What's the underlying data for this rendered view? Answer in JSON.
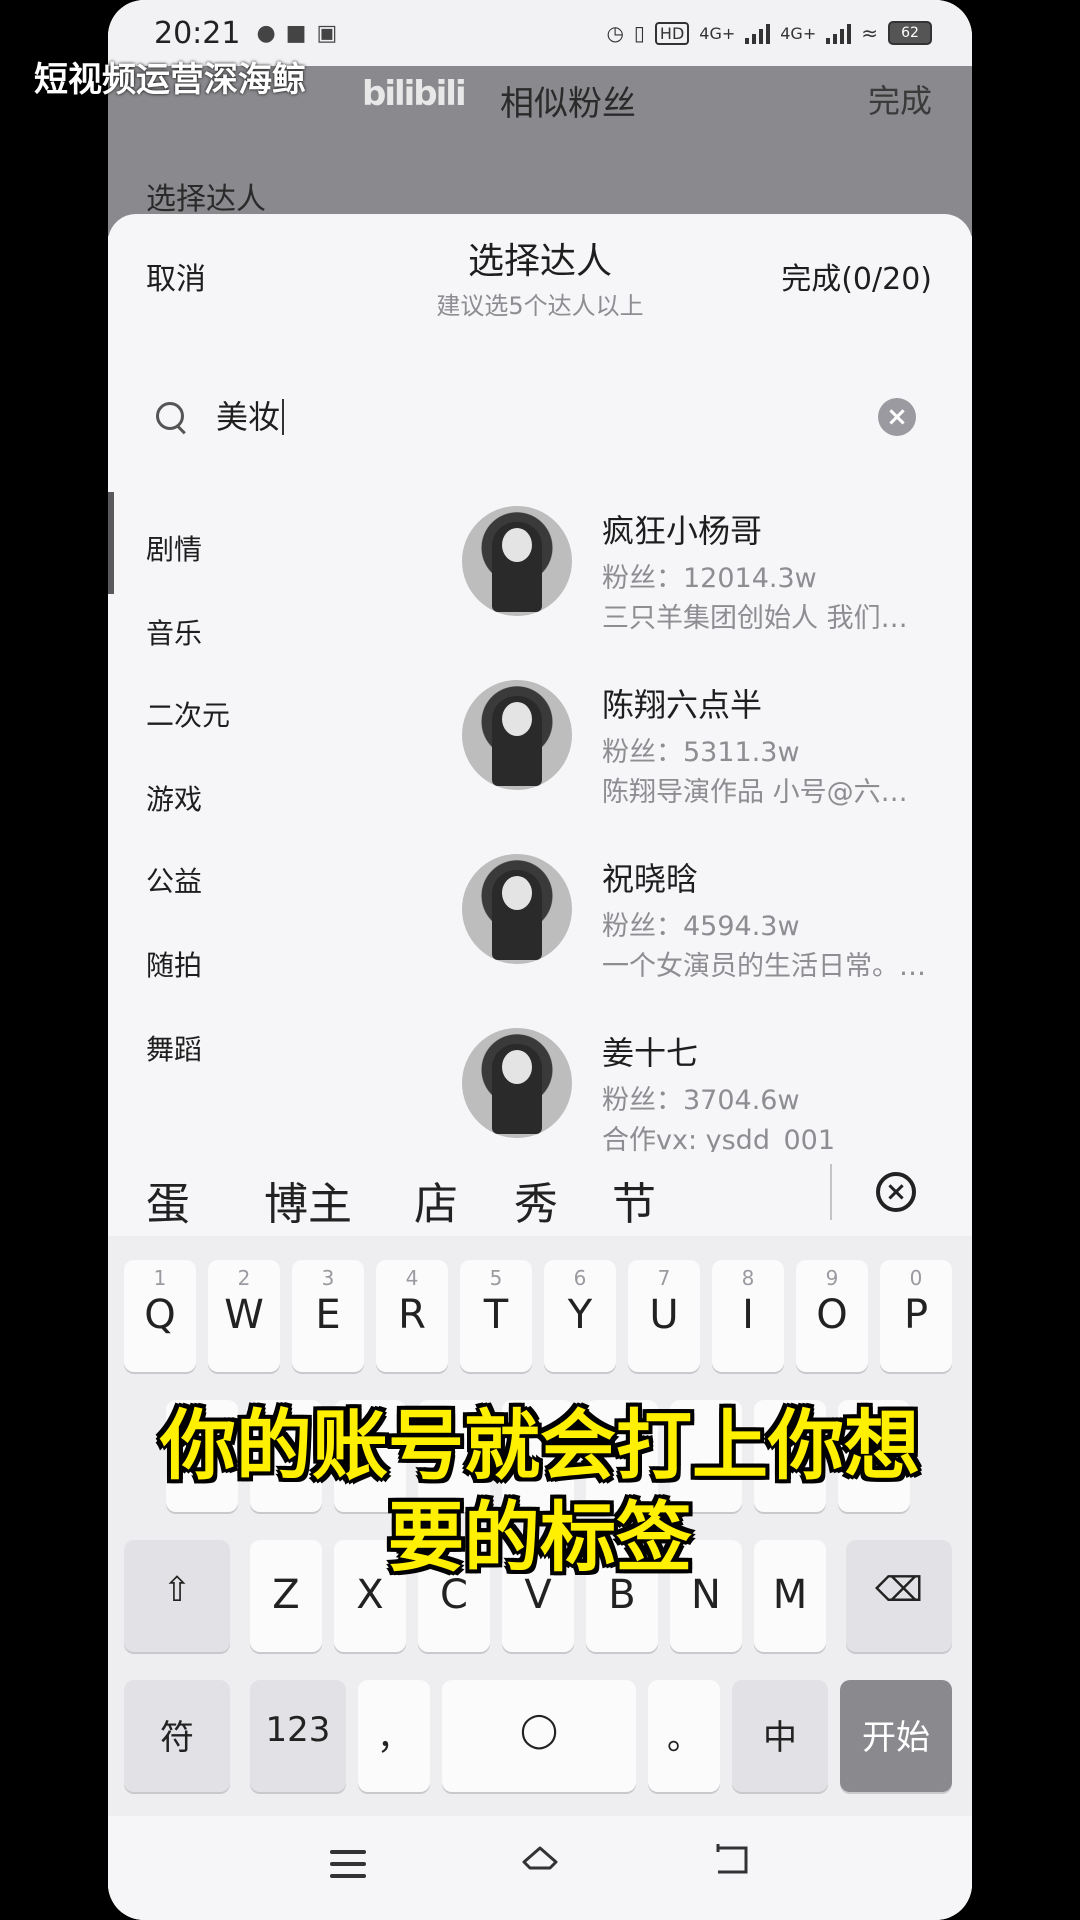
{
  "watermark": "短视频运营深海鲸",
  "status_bar": {
    "time": "20:21",
    "network_1": "4G+",
    "network_2": "4G+",
    "hd": "HD",
    "battery": "62"
  },
  "background_page": {
    "logo": "bilibili",
    "title": "相似粉丝",
    "done": "完成",
    "section": "选择达人"
  },
  "sheet": {
    "cancel_label": "取消",
    "title": "选择达人",
    "subtitle": "建议选5个达人以上",
    "done_label": "完成(0/20)"
  },
  "search": {
    "value": "美妆"
  },
  "categories": [
    "剧情",
    "音乐",
    "二次元",
    "游戏",
    "公益",
    "随拍",
    "舞蹈"
  ],
  "creators": [
    {
      "name": "疯狂小杨哥",
      "fans": "粉丝：12014.3w",
      "desc": "三只羊集团创始人 我们…"
    },
    {
      "name": "陈翔六点半",
      "fans": "粉丝：5311.3w",
      "desc": "陈翔导演作品 小号@六…"
    },
    {
      "name": "祝晓晗",
      "fans": "粉丝：4594.3w",
      "desc": "一个女演员的生活日常。…"
    },
    {
      "name": "姜十七",
      "fans": "粉丝：3704.6w",
      "desc": "合作vx: ysdd_001"
    }
  ],
  "candidates": [
    "蛋",
    "博主",
    "店",
    "秀",
    "节"
  ],
  "keyboard": {
    "row1": [
      {
        "num": "1",
        "ch": "Q"
      },
      {
        "num": "2",
        "ch": "W"
      },
      {
        "num": "3",
        "ch": "E"
      },
      {
        "num": "4",
        "ch": "R"
      },
      {
        "num": "5",
        "ch": "T"
      },
      {
        "num": "6",
        "ch": "Y"
      },
      {
        "num": "7",
        "ch": "U"
      },
      {
        "num": "8",
        "ch": "I"
      },
      {
        "num": "9",
        "ch": "O"
      },
      {
        "num": "0",
        "ch": "P"
      }
    ],
    "row3": [
      "Z",
      "X",
      "C",
      "V",
      "B",
      "N",
      "M"
    ],
    "symbols": "符",
    "numbers": "123",
    "comma": "，",
    "period": "。",
    "lang": "中",
    "go": "开始"
  },
  "caption": {
    "line1": "你的账号就会打上你想",
    "line2": "要的标签"
  }
}
